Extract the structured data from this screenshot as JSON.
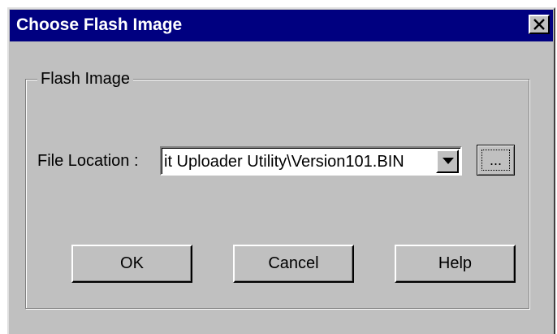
{
  "window": {
    "title": "Choose Flash Image",
    "close_glyph": "×"
  },
  "group": {
    "label": "Flash Image"
  },
  "file_location": {
    "label": "File Location :",
    "value": "it Uploader Utility\\Version101.BIN",
    "browse_label": "..."
  },
  "buttons": {
    "ok": "OK",
    "cancel": "Cancel",
    "help": "Help"
  },
  "colors": {
    "titlebar": "#000080",
    "face": "#c0c0c0"
  },
  "icons": {
    "close": "close-icon",
    "dropdown": "chevron-down-icon"
  }
}
